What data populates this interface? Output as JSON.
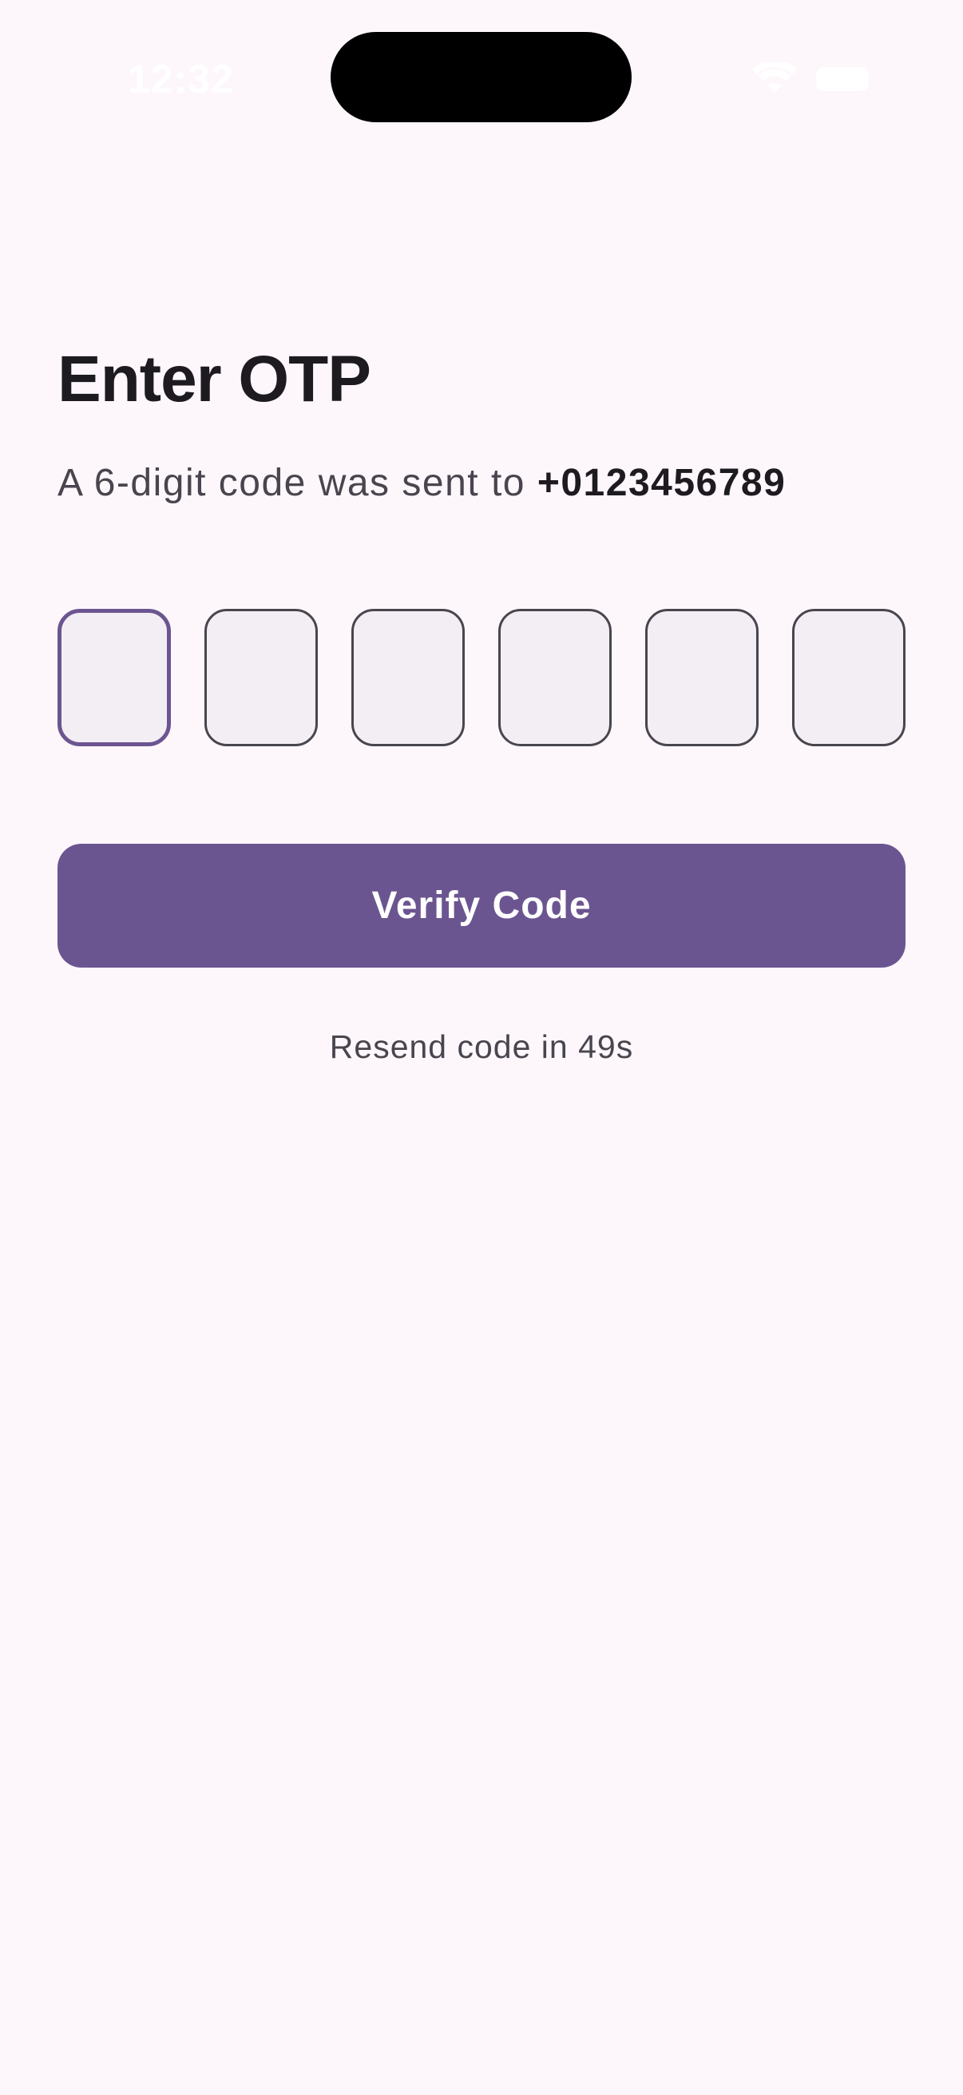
{
  "status_bar": {
    "time": "12:32",
    "icons": [
      "wifi-icon",
      "battery-icon"
    ]
  },
  "screen": {
    "title": "Enter OTP",
    "subtitle_prefix": "A 6-digit code was sent to ",
    "phone_number": "+0123456789",
    "otp_digits": [
      "",
      "",
      "",
      "",
      "",
      ""
    ],
    "focused_digit_index": 0,
    "verify_button_label": "Verify Code",
    "resend_text": "Resend code in 49s"
  },
  "colors": {
    "background": "#fdf7fc",
    "primary": "#6b5590",
    "text_primary": "#1d1a20",
    "text_secondary": "#49454e",
    "input_fill": "#f3eef3"
  }
}
